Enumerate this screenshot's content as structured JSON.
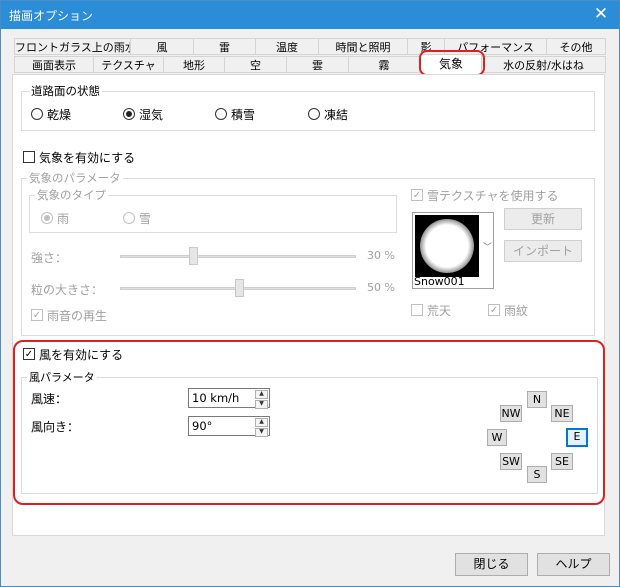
{
  "window": {
    "title": "描画オプション",
    "close_glyph": "✕"
  },
  "tabs_row1": [
    "フロントガラス上の雨水",
    "風",
    "雷",
    "温度",
    "時間と照明",
    "影",
    "パフォーマンス",
    "その他"
  ],
  "tabs_row2": [
    "画面表示",
    "テクスチャ",
    "地形",
    "空",
    "雲",
    "霧",
    "気象",
    "水の反射/水はね"
  ],
  "road_state": {
    "title": "道路面の状態",
    "options": [
      "乾燥",
      "湿気",
      "積雪",
      "凍結"
    ],
    "selected": 1
  },
  "weather_enable": {
    "label": "気象を有効にする",
    "checked": false
  },
  "weather_params": {
    "title": "気象のパラメータ",
    "type_title": "気象のタイプ",
    "types": [
      "雨",
      "雪"
    ],
    "type_selected": 0,
    "strength_label": "強さ：",
    "strength_value": "30 %",
    "strength_level": 0.3,
    "size_label": "粒の大きさ：",
    "size_value": "50 %",
    "size_level": 0.5,
    "rain_sound_label": "雨音の再生",
    "rain_sound_checked": true,
    "snow_texture_label": "雪テクスチャを使用する",
    "snow_texture_checked": true,
    "texture_name": "Snow001",
    "update_button": "更新",
    "import_button": "インポート",
    "stormy_label": "荒天",
    "stormy_checked": false,
    "ripple_label": "雨紋",
    "ripple_checked": true
  },
  "wind": {
    "enable_label": "風を有効にする",
    "enable_checked": true,
    "params_title": "風パラメータ",
    "speed_label": "風速：",
    "speed_value": "10 km/h",
    "direction_label": "風向き：",
    "direction_value": "90°",
    "directions": {
      "N": "N",
      "NE": "NE",
      "E": "E",
      "SE": "SE",
      "S": "S",
      "SW": "SW",
      "W": "W",
      "NW": "NW"
    },
    "selected_direction": "E"
  },
  "footer": {
    "close_button": "閉じる",
    "help_button": "ヘルプ"
  },
  "accent_color": "#e02020"
}
